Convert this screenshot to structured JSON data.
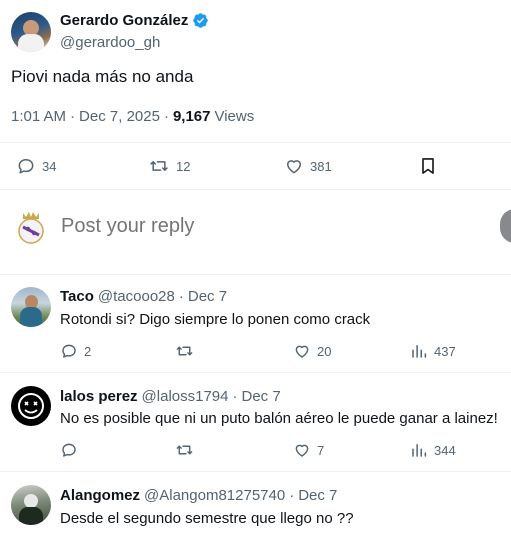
{
  "tweet": {
    "author_name": "Gerardo González",
    "author_handle": "@gerardoo_gh",
    "text": "Piovi nada más no anda",
    "time": "1:01 AM",
    "date": "Dec 7, 2025",
    "views_count": "9,167",
    "views_label": "Views",
    "replies": "34",
    "retweets": "12",
    "likes": "381"
  },
  "reply_box": {
    "placeholder": "Post your reply"
  },
  "replies": [
    {
      "name": "Taco",
      "handle": "@tacooo28",
      "date": "Dec 7",
      "text": "Rotondi si? Digo siempre lo ponen como crack",
      "replies": "2",
      "retweets": "",
      "likes": "20",
      "views": "437"
    },
    {
      "name": "lalos perez",
      "handle": "@laloss1794",
      "date": "Dec 7",
      "text": "No es posible que ni un puto balón aéreo le puede ganar a lainez!",
      "replies": "",
      "retweets": "",
      "likes": "7",
      "views": "344"
    },
    {
      "name": "Alangomez",
      "handle": "@Alangom81275740",
      "date": "Dec 7",
      "text": "Desde el segundo semestre que llego no ??"
    }
  ],
  "separator": "·",
  "colors": {
    "verified": "#1d9bf0",
    "muted": "#536471",
    "divider": "#eff3f4"
  }
}
